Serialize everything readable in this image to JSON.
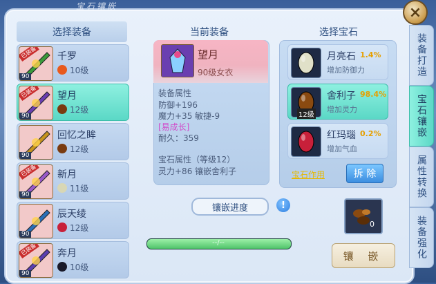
{
  "window": {
    "title": "宝石镶嵌",
    "close": "×"
  },
  "left": {
    "title": "选择装备",
    "items": [
      {
        "name": "千罗",
        "level": "10级",
        "tag": "90",
        "badge": "已装备",
        "gem_color": "#e85a1e",
        "icon_color": "#3b9a3b"
      },
      {
        "name": "望月",
        "level": "12级",
        "tag": "90",
        "badge": "已装备",
        "gem_color": "#7a3b10",
        "icon_color": "#6a3fb0"
      },
      {
        "name": "回忆之眸",
        "level": "12级",
        "tag": "90",
        "badge": "",
        "gem_color": "#7a3b10",
        "icon_color": "#c8941e"
      },
      {
        "name": "新月",
        "level": "11级",
        "tag": "90",
        "badge": "已装备",
        "gem_color": "#d8d7b5",
        "icon_color": "#9a5ac8"
      },
      {
        "name": "辰天绫",
        "level": "12级",
        "tag": "90",
        "badge": "",
        "gem_color": "#c8203a",
        "icon_color": "#2a6fb8"
      },
      {
        "name": "奔月",
        "level": "10级",
        "tag": "90",
        "badge": "已装备",
        "gem_color": "#1a1a2a",
        "icon_color": "#5a3fb0"
      }
    ]
  },
  "middle": {
    "title": "当前装备",
    "name": "望月",
    "sub": "90级女衣",
    "attr_title": "装备属性",
    "attr_line1": "防御+196",
    "attr_line2": "魔力+35 敏捷-9",
    "special": "[易成长]",
    "durability": "耐久：359",
    "gem_title": "宝石属性（等级12）",
    "gem_attr": "灵力+86 镶嵌舍利子"
  },
  "progress": {
    "label": "镶嵌进度",
    "info": "!",
    "text": "--/--",
    "value": 1.0
  },
  "right": {
    "title": "选择宝石",
    "gems": [
      {
        "name": "月亮石",
        "rate": "1.4%",
        "effect": "增加防御力",
        "level": "",
        "color": "#e0e0c8"
      },
      {
        "name": "舍利子",
        "rate": "98.4%",
        "effect": "增加灵力",
        "level": "12级",
        "color": "#8a4a10"
      },
      {
        "name": "红玛瑙",
        "rate": "0.2%",
        "effect": "增加气血",
        "level": "",
        "color": "#c8203a"
      }
    ],
    "gem_function_link": "宝石作用",
    "remove_button": "拆 除"
  },
  "slot": {
    "count": "0"
  },
  "inlay_button": "镶 嵌",
  "side_tabs": [
    {
      "label": "装备打造"
    },
    {
      "label": "宝石镶嵌"
    },
    {
      "label": "属性转换"
    },
    {
      "label": "装备强化"
    }
  ],
  "colors": {
    "accent": "#5bd8c6",
    "title": "#2e4f80",
    "rate": "#e6a000"
  }
}
